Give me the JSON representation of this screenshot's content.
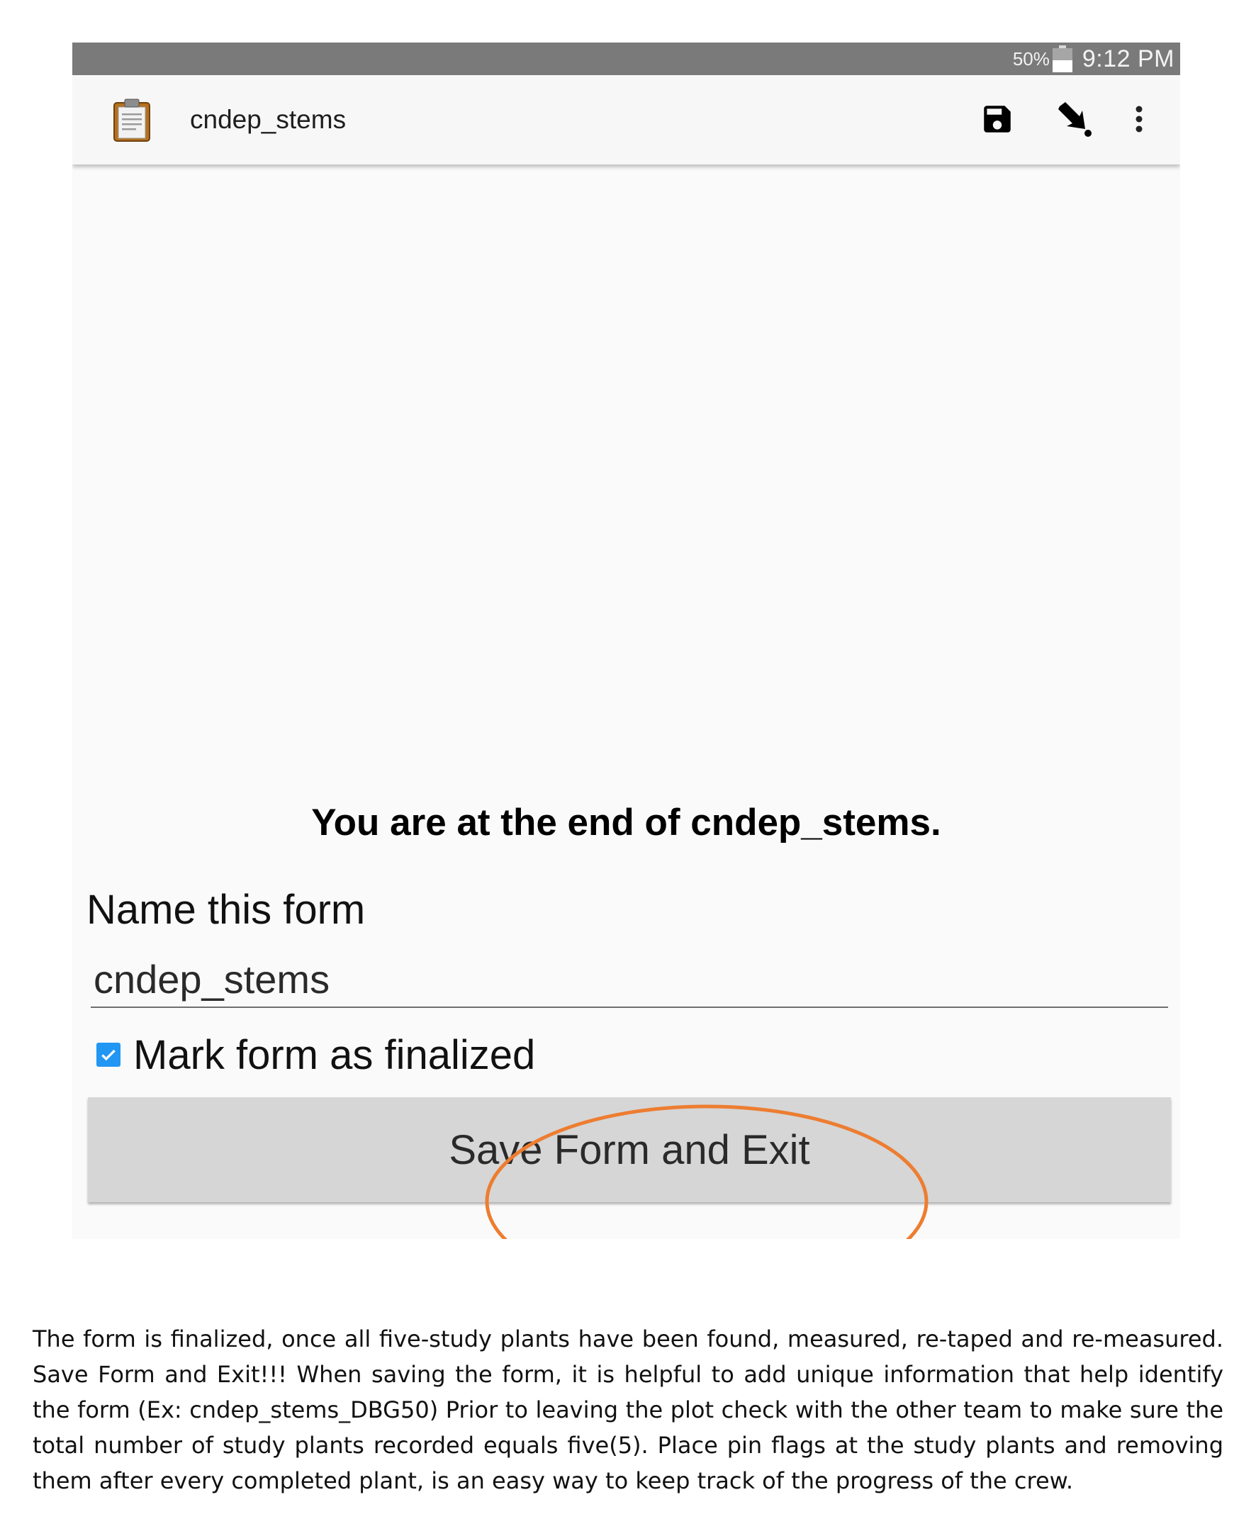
{
  "status_bar": {
    "battery_percent": "50%",
    "battery_level": 0.5,
    "time": "9:12 PM"
  },
  "app_bar": {
    "icon": "clipboard-icon",
    "title": "cndep_stems",
    "actions": [
      "save-icon",
      "jump-arrow-icon",
      "overflow-menu-icon"
    ]
  },
  "form_end": {
    "heading": "You are at the end of cndep_stems.",
    "name_label": "Name this form",
    "name_value": "cndep_stems",
    "finalize_checked": true,
    "finalize_label": "Mark form as finalized",
    "save_button_label": "Save Form and Exit"
  },
  "annotation": {
    "highlight_color": "#ed7d31"
  },
  "colors": {
    "status_bar": "#7a7a7a",
    "app_bar": "#f7f7f7",
    "content_bg": "#fafafa",
    "checkbox": "#2196f3",
    "button": "#d6d6d6"
  },
  "instructions": {
    "text": "The form is finalized, once all five-study plants have been found, measured, re-taped and re-measured. Save Form and Exit!!!   When saving the form, it is helpful to add unique information that help identify the form (Ex:   cndep_stems_DBG50)  Prior to leaving the plot check with the other team to make sure the total number of study plants recorded equals five(5).  Place pin flags at the study plants and removing them after every completed plant, is an easy way to keep track of the progress of the crew."
  }
}
